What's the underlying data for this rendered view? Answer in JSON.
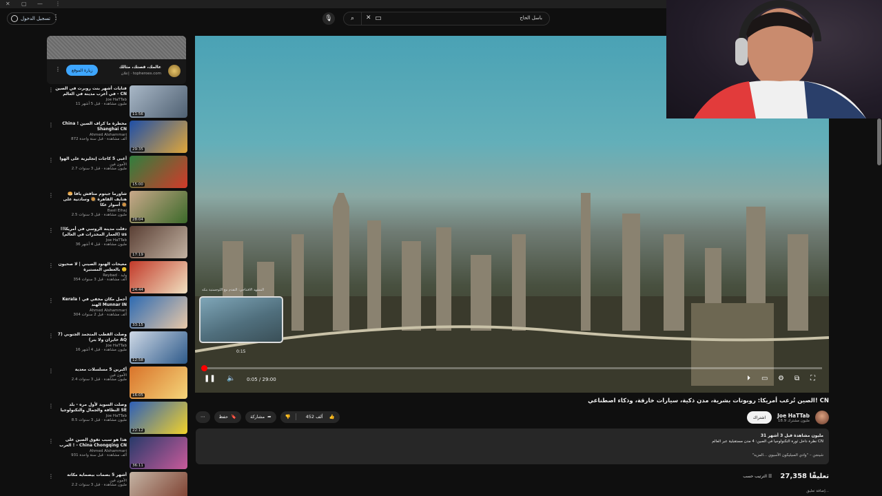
{
  "window": {
    "close": "✕",
    "restore": "▢",
    "minimize": "—",
    "menu": "⋮"
  },
  "header": {
    "sign_in": "تسجيل الدخول",
    "search_value": "باسل الحاج",
    "search_icon": "search-icon",
    "mic_icon": "mic-icon"
  },
  "ad": {
    "title": "عالمك، قصتك، مثالك",
    "sponsor": "إعلان · topheroes.com",
    "button": "زيارة الموقع"
  },
  "related": [
    {
      "title": "فتايات أشهر بنت روبرت في الصين - في أعرب مدينة في العالم CN",
      "channel": "Joe HaTTab",
      "stats": "11 مليون مشاهدة · قبل 5 أشهر",
      "duration": "11:56"
    },
    {
      "title": "China ! مخطرة ما كراف الصين Shanghai CN",
      "channel": "Ahmed Alshammari",
      "stats": "872 ألف مشاهدة · قبل سنة واحدة",
      "duration": "29:35"
    },
    {
      "title": "أغبى 5 كاجات إنجليزية على الهوا",
      "channel": "الأمون فين",
      "stats": "2.7 مليون مشاهدة · قبل 3 سنوات",
      "duration": "15:00"
    },
    {
      "title": "شاورما جيتوم متافش يافا 🥯 هتايف القاهرة 🥘 وسادتية على أسوار عكا 🥘",
      "channel": "Basil Elhaj",
      "stats": "2.5 مليون مشاهدة · قبل 3 سنوات",
      "duration": "28:04"
    },
    {
      "title": "دفلت مدينة الروسي في أمريكا!! (العمار المخدرات في العالم) us",
      "channel": "Joe HaTTab",
      "stats": "36 مليون مشاهدة · قبل 4 أشهر",
      "duration": "17:19"
    },
    {
      "title": "مغيحات الهنود الصيني | لا صحيون بالعطس المستبرة 🙂",
      "channel": "Reybad · وليد",
      "stats": "354 ألف مشاهدة · قبل 3 سنوات",
      "duration": "24:44"
    },
    {
      "title": "Kerala ! أجمل مكان مخفي في الهند Munnar IN",
      "channel": "Ahmed Alshammari",
      "stats": "304 ألف مشاهدة · قبل 2 سنوات",
      "duration": "33:15"
    },
    {
      "title": "وصلت القطب المتجمد الجنوبي (7 خايران ولا بتر) AQ",
      "channel": "Joe HaTTab",
      "stats": "16 مليون مشاهدة · قبل 4 أشهر",
      "duration": "12:58"
    },
    {
      "title": "أكبرين 5 مسلسلات معدية",
      "channel": "الأمون فين",
      "stats": "2.4 مليون مشاهدة · قبل 3 سنوات",
      "duration": "16:05"
    },
    {
      "title": "وصلت السويد لأول مره - بلد النظافة والجمال والتكنولوجيا SE",
      "channel": "Joe HaTTab",
      "stats": "8.5 مليون مشاهدة · قبل 3 سنوات",
      "duration": "22:12"
    },
    {
      "title": "هذا هو سبب تفوق الصين على الغرب ! - China Chongqing CN",
      "channel": "Ahmed Alshammari",
      "stats": "931 ألف مشاهدة · قبل سنة واحدة",
      "duration": "36:11"
    },
    {
      "title": "أشهر 5 بصمات بيصماية مكاتة",
      "channel": "الأمون فين",
      "stats": "2.2 مليون مشاهدة · قبل 3 سنوات",
      "duration": ""
    }
  ],
  "player": {
    "current_time": "0:05 / 29:00",
    "preview_time": "0:15",
    "chapter": "المشهد الافتتاحي: التقدم مع اللوجستية بنكه",
    "progress_fraction": 0.003
  },
  "video": {
    "title": "الصين تُرعب أمريكا: روبوتات بشرية، مدن ذكية، سيارات خارقة، وذكاء اصطناعي! CN",
    "channel": "Joe HaTTab",
    "subscribers": "18.9 مليون مشترك",
    "subscribe": "اشتراك",
    "likes": "452 ألف",
    "share": "مشاركة",
    "save": "حفظ",
    "views_date": "31 مليون مشاهدة  قبل 3 أشهر",
    "desc_line": "نظرة داخل ثورة التكنولوجيا في الصين: 4 مدن مستقبلية عبر العالم CN",
    "desc_more": "\"شينجن – \"وادي السيليكون الآسيوي ...المزيد",
    "comments_count": "27,358 تعليقًا",
    "sort": "الترتيب حسب",
    "add_comment": "إضافة تعليق..."
  }
}
